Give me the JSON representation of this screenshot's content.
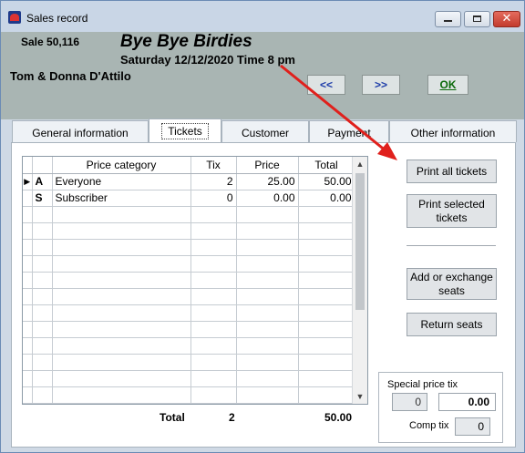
{
  "window": {
    "title": "Sales record",
    "close_glyph": "✕"
  },
  "header": {
    "sale_number": "Sale 50,116",
    "show_title": "Bye Bye Birdies",
    "show_datetime": "Saturday 12/12/2020  Time 8 pm",
    "customer_name": "Tom & Donna D'Attilo",
    "prev_label": "<<",
    "next_label": ">>",
    "ok_label": "OK"
  },
  "tabs": [
    {
      "label": "General information",
      "active": false
    },
    {
      "label": "Tickets",
      "active": true
    },
    {
      "label": "Customer",
      "active": false
    },
    {
      "label": "Payment",
      "active": false
    },
    {
      "label": "Other information",
      "active": false
    }
  ],
  "grid": {
    "columns": [
      "",
      "",
      "Price category",
      "Tix",
      "Price",
      "Total"
    ],
    "rows": [
      {
        "indicator": "▶",
        "code": "A",
        "category": "Everyone",
        "tix": "2",
        "price": "25.00",
        "total": "50.00"
      },
      {
        "indicator": "",
        "code": "S",
        "category": "Subscriber",
        "tix": "0",
        "price": "0.00",
        "total": "0.00"
      }
    ],
    "empty_rows": 12,
    "scroll_up_glyph": "▲",
    "scroll_down_glyph": "▼"
  },
  "totals": {
    "label": "Total",
    "tix": "2",
    "total": "50.00"
  },
  "actions": {
    "print_all": "Print all tickets",
    "print_selected_line1": "Print selected",
    "print_selected_line2": "tickets",
    "exchange_line1": "Add or exchange",
    "exchange_line2": "seats",
    "return": "Return seats"
  },
  "special_price": {
    "label": "Special price tix",
    "count": "0",
    "amount": "0.00",
    "comp_label": "Comp tix",
    "comp_count": "0"
  },
  "colors": {
    "header_bg": "#a9b5b3",
    "annotation_arrow": "#e0201c",
    "link_blue": "#1a3aa8",
    "ok_green": "#0a6a0a"
  },
  "icons": [
    "app-icon",
    "minimize-icon",
    "maximize-icon",
    "close-icon",
    "row-pointer-icon",
    "scroll-up-icon",
    "scroll-down-icon"
  ]
}
